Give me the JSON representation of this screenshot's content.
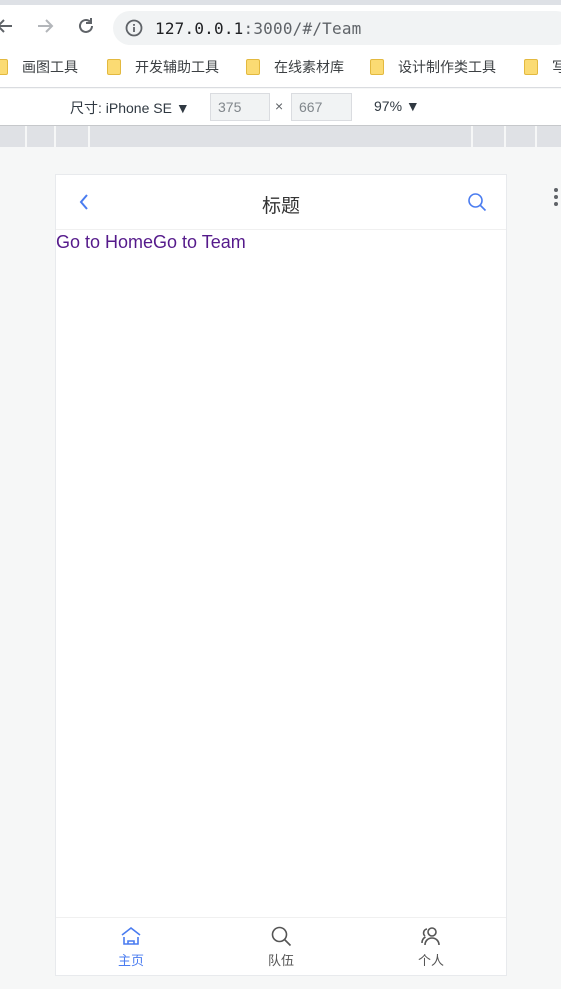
{
  "browser": {
    "url_host": "127.0.0.1",
    "url_rest": ":3000/#/Team",
    "bookmarks": [
      "画图工具",
      "开发辅助工具",
      "在线素材库",
      "设计制作类工具",
      "写"
    ]
  },
  "devtools": {
    "device_label": "尺寸: iPhone SE",
    "width": "375",
    "height": "667",
    "times": "×",
    "zoom": "97%"
  },
  "app": {
    "header": {
      "title": "标题"
    },
    "links": {
      "home": "Go to Home",
      "team": "Go to Team"
    },
    "tabs": [
      {
        "label": "主页",
        "icon": "home-icon",
        "active": true
      },
      {
        "label": "队伍",
        "icon": "search-icon",
        "active": false
      },
      {
        "label": "个人",
        "icon": "user-icon",
        "active": false
      }
    ],
    "accent": "#4a7cf0",
    "link_color": "#551a8b"
  }
}
